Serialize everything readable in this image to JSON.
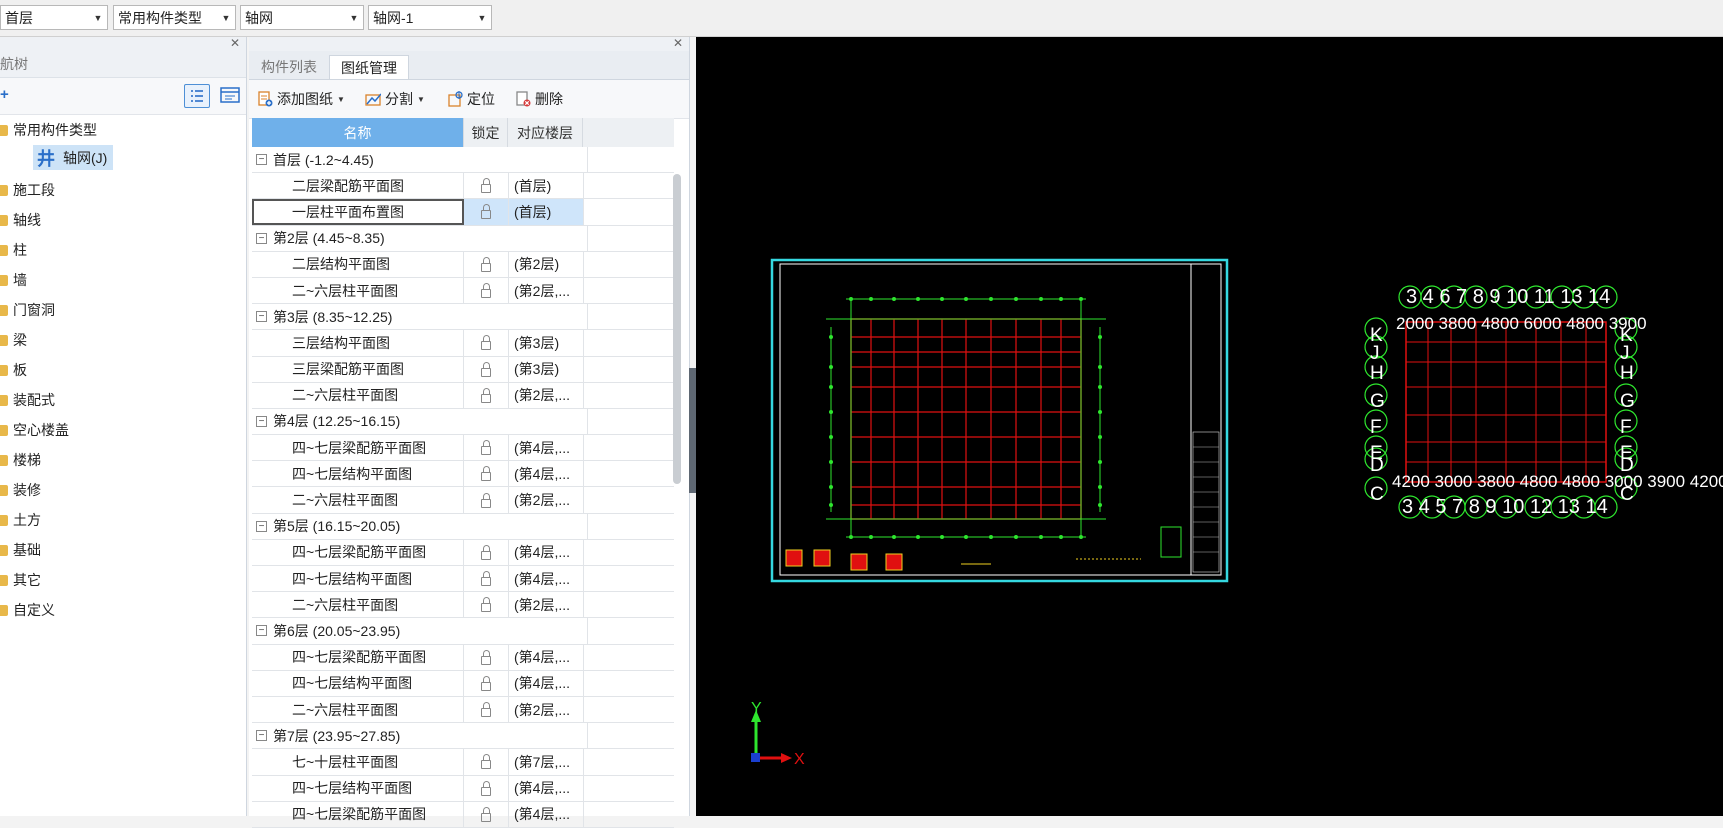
{
  "toolbar": {
    "floor": "首层",
    "category": "常用构件类型",
    "component": "轴网",
    "instance": "轴网-1"
  },
  "nav": {
    "title": "导航树",
    "root": "常用构件类型",
    "selected_child": "轴网(J)",
    "items": [
      "施工段",
      "轴线",
      "柱",
      "墙",
      "门窗洞",
      "梁",
      "板",
      "装配式",
      "空心楼盖",
      "楼梯",
      "装修",
      "土方",
      "基础",
      "其它",
      "自定义"
    ]
  },
  "drawing": {
    "tabs": [
      "构件列表",
      "图纸管理"
    ],
    "active_tab": "图纸管理",
    "tools": {
      "add": "添加图纸",
      "split": "分割",
      "locate": "定位",
      "delete": "删除"
    },
    "columns": {
      "name": "名称",
      "lock": "锁定",
      "floor": "对应楼层"
    },
    "groups": [
      {
        "title": "首层 (-1.2~4.45)",
        "rows": [
          {
            "name": "二层梁配筋平面图",
            "floor": "(首层)"
          },
          {
            "name": "一层柱平面布置图",
            "floor": "(首层)",
            "selected": true
          }
        ]
      },
      {
        "title": "第2层 (4.45~8.35)",
        "rows": [
          {
            "name": "二层结构平面图",
            "floor": "(第2层)"
          },
          {
            "name": "二~六层柱平面图",
            "floor": "(第2层,..."
          }
        ]
      },
      {
        "title": "第3层 (8.35~12.25)",
        "rows": [
          {
            "name": "三层结构平面图",
            "floor": "(第3层)"
          },
          {
            "name": "三层梁配筋平面图",
            "floor": "(第3层)"
          },
          {
            "name": "二~六层柱平面图",
            "floor": "(第2层,..."
          }
        ]
      },
      {
        "title": "第4层 (12.25~16.15)",
        "rows": [
          {
            "name": "四~七层梁配筋平面图",
            "floor": "(第4层,..."
          },
          {
            "name": "四~七层结构平面图",
            "floor": "(第4层,..."
          },
          {
            "name": "二~六层柱平面图",
            "floor": "(第2层,..."
          }
        ]
      },
      {
        "title": "第5层 (16.15~20.05)",
        "rows": [
          {
            "name": "四~七层梁配筋平面图",
            "floor": "(第4层,..."
          },
          {
            "name": "四~七层结构平面图",
            "floor": "(第4层,..."
          },
          {
            "name": "二~六层柱平面图",
            "floor": "(第2层,..."
          }
        ]
      },
      {
        "title": "第6层 (20.05~23.95)",
        "rows": [
          {
            "name": "四~七层梁配筋平面图",
            "floor": "(第4层,..."
          },
          {
            "name": "四~七层结构平面图",
            "floor": "(第4层,..."
          },
          {
            "name": "二~六层柱平面图",
            "floor": "(第2层,..."
          }
        ]
      },
      {
        "title": "第7层 (23.95~27.85)",
        "rows": [
          {
            "name": "七~十层柱平面图",
            "floor": "(第7层,..."
          },
          {
            "name": "四~七层结构平面图",
            "floor": "(第4层,..."
          },
          {
            "name": "四~七层梁配筋平面图",
            "floor": "(第4层,..."
          }
        ]
      }
    ]
  },
  "canvas": {
    "axis_x": "X",
    "axis_y": "Y",
    "grid_top": "3 4 6 7  8  9  10 11 13 14",
    "grid_top2": "2000 3800 4800 6000 4800 3900",
    "grid_bottom": "3 4 5  7  8  9  10 12 13 14",
    "grid_bottom2": "4200 3000 3800 4800 4800 3000 3900 4200",
    "grid_left": [
      "K",
      "J",
      "H",
      "G",
      "F",
      "E",
      "D",
      "C"
    ],
    "grid_right": [
      "K",
      "J",
      "H",
      "G",
      "F",
      "E",
      "D",
      "C"
    ]
  }
}
